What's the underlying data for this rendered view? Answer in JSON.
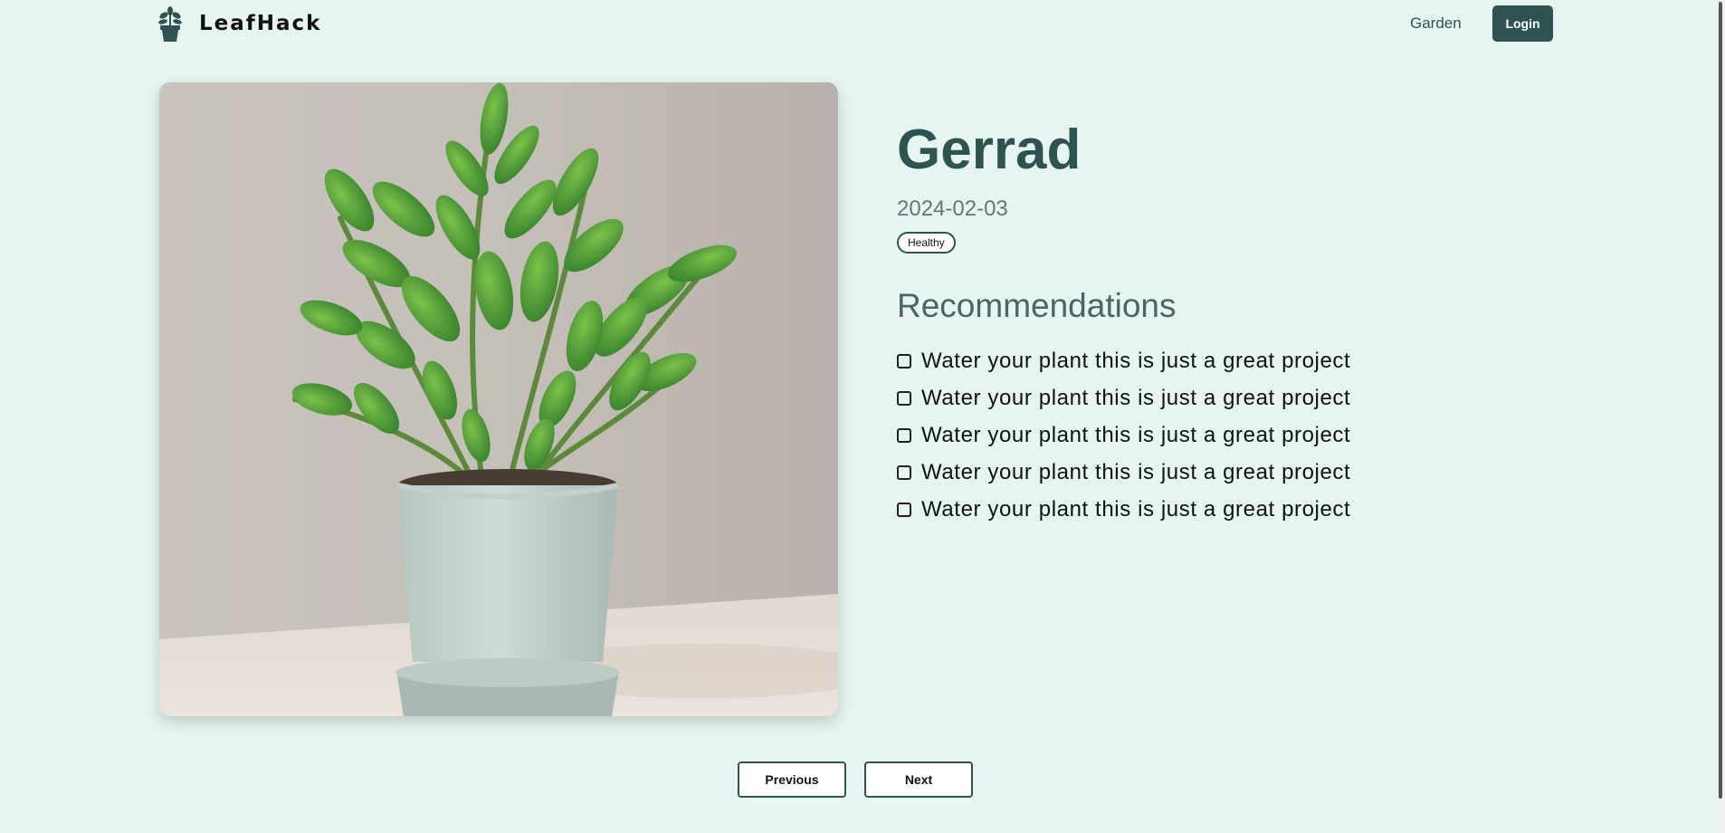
{
  "header": {
    "brand": "LeafHack",
    "nav_garden": "Garden",
    "login_label": "Login"
  },
  "plant": {
    "name": "Gerrad",
    "date": "2024-02-03",
    "status": "Healthy"
  },
  "recommendations": {
    "title": "Recommendations",
    "items": [
      {
        "text": "Water your plant this is just a great project",
        "checked": false
      },
      {
        "text": "Water your plant this is just a great project",
        "checked": false
      },
      {
        "text": "Water your plant this is just a great project",
        "checked": false
      },
      {
        "text": "Water your plant this is just a great project",
        "checked": false
      },
      {
        "text": "Water your plant this is just a great project",
        "checked": false
      }
    ]
  },
  "pagination": {
    "previous_label": "Previous",
    "next_label": "Next"
  },
  "colors": {
    "background": "#e6f5f2",
    "accent": "#2f5350"
  }
}
